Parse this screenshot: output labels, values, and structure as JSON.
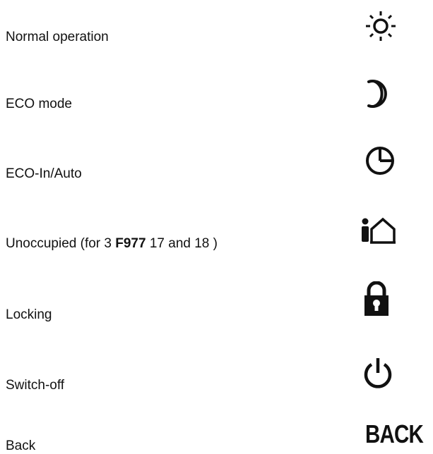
{
  "legend": {
    "items": [
      {
        "label": "Normal operation",
        "icon": "sun-icon"
      },
      {
        "label": "ECO mode",
        "icon": "moon-icon"
      },
      {
        "label": "ECO-In/Auto",
        "icon": "clock-icon"
      },
      {
        "label_parts": {
          "before": "Unoccupied (for 3 ",
          "bold": "F977",
          "after": " 17 and 18 )"
        },
        "icon": "person-house-icon"
      },
      {
        "label": "Locking",
        "icon": "lock-icon"
      },
      {
        "label": "Switch-off",
        "icon": "power-icon"
      },
      {
        "label": "Back",
        "icon": "back-icon",
        "icon_text": "BACK"
      }
    ]
  }
}
